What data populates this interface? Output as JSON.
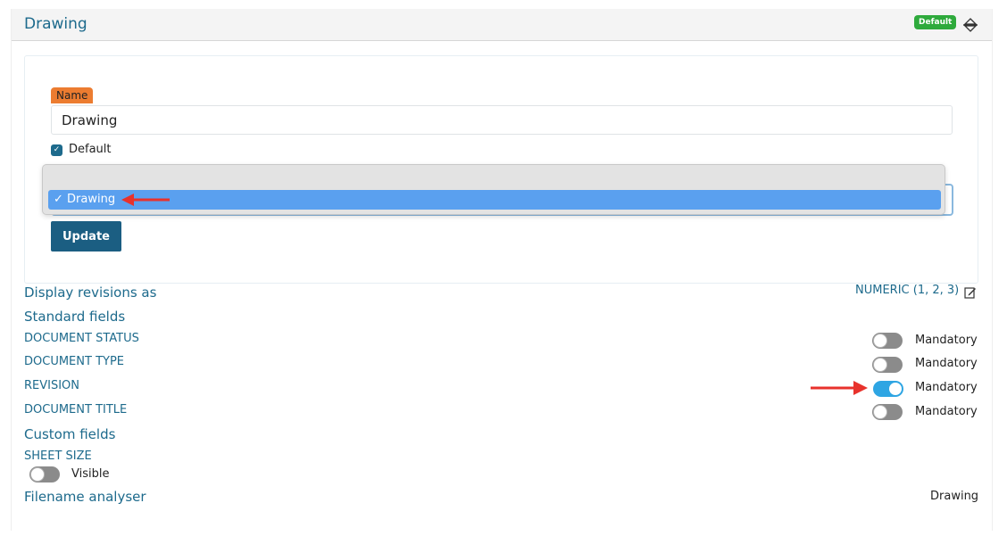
{
  "header": {
    "title": "Drawing",
    "badge": "Default",
    "sort_icon": "sort-icon"
  },
  "form": {
    "name_label": "Name",
    "name_value": "Drawing",
    "default_label": "Default",
    "default_checked": true,
    "dropdown": {
      "selected": "Drawing",
      "check_mark": "✓"
    },
    "update_label": "Update"
  },
  "settings": {
    "display_revisions_label": "Display revisions as",
    "display_revisions_value": "NUMERIC (1, 2, 3)",
    "edit_icon": "edit-icon",
    "standard_fields_heading": "Standard fields",
    "standard_fields": [
      {
        "label": "DOCUMENT STATUS",
        "toggle_label": "Mandatory",
        "on": false
      },
      {
        "label": "DOCUMENT TYPE",
        "toggle_label": "Mandatory",
        "on": false
      },
      {
        "label": "REVISION",
        "toggle_label": "Mandatory",
        "on": true
      },
      {
        "label": "DOCUMENT TITLE",
        "toggle_label": "Mandatory",
        "on": false
      }
    ],
    "custom_fields_heading": "Custom fields",
    "custom_fields": [
      {
        "label": "SHEET SIZE",
        "toggle_label": "Visible",
        "on": false
      }
    ],
    "filename_analyser_label": "Filename analyser",
    "filename_analyser_value": "Drawing"
  },
  "colors": {
    "accent": "#1d6a8c",
    "badge": "#2eaa3c",
    "name_tag": "#ec7c30",
    "toggle_on": "#2ea5e3",
    "annotation_arrow": "#e8322c"
  }
}
